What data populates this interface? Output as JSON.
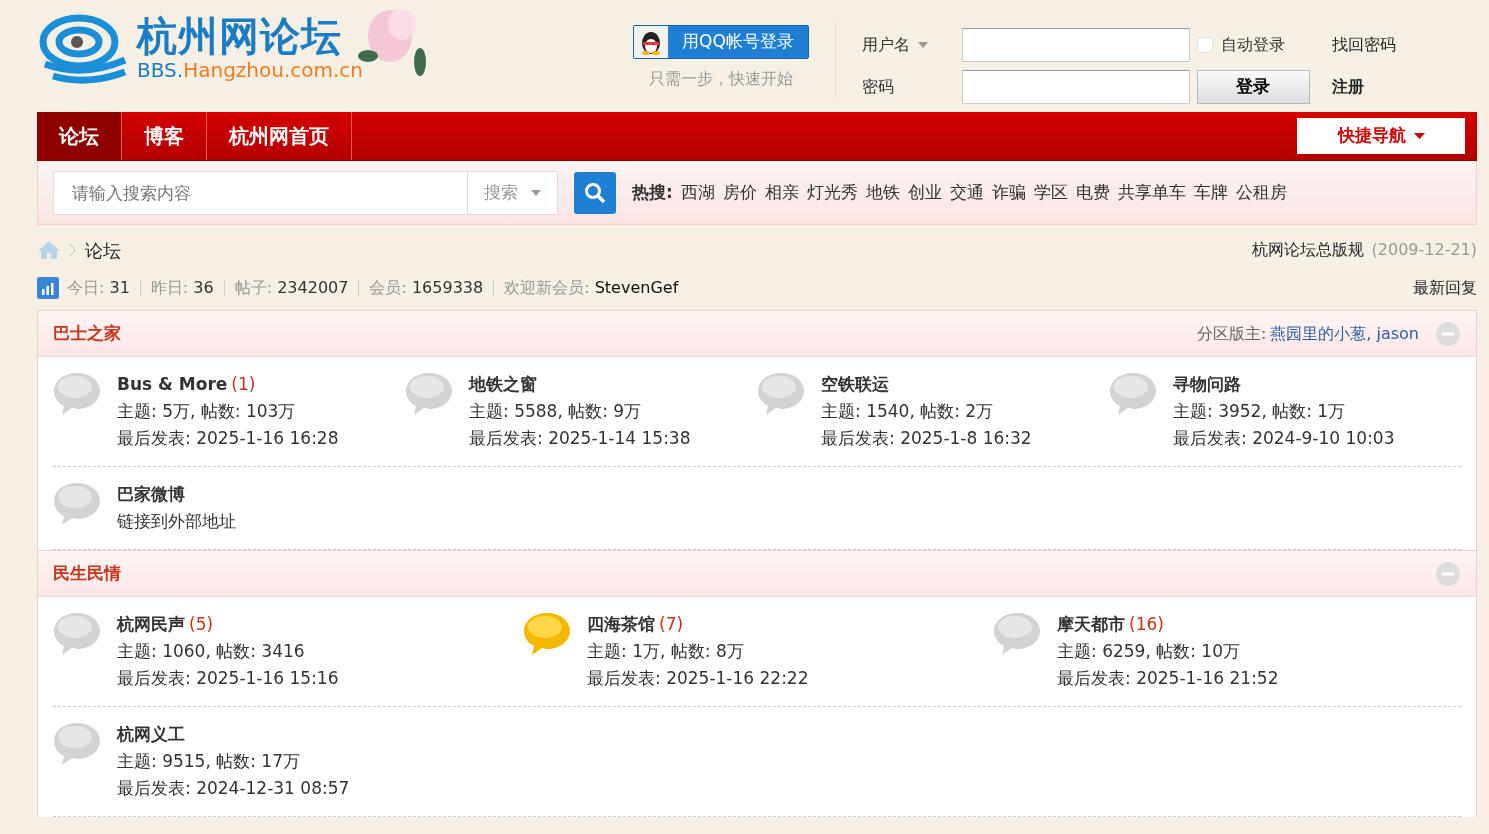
{
  "logo": {
    "title": "杭州网论坛",
    "url_prefix": "BBS.",
    "url_domain": "Hangzhou.com.cn"
  },
  "qq_login": {
    "button": "用QQ帐号登录",
    "hint": "只需一步，快速开始"
  },
  "login": {
    "username_label": "用户名",
    "password_label": "密码",
    "auto_login": {
      "label": "自动登录",
      "checked": false
    },
    "login_button": "登录",
    "forgot_link": "找回密码",
    "register_link": "注册"
  },
  "nav": {
    "items": [
      {
        "label": "论坛",
        "selected": true
      },
      {
        "label": "博客",
        "selected": false
      },
      {
        "label": "杭州网首页",
        "selected": false
      }
    ],
    "quick_nav": "快捷导航"
  },
  "search": {
    "placeholder": "请输入搜索内容",
    "type": "搜索",
    "hot_label": "热搜:",
    "hot": [
      "西湖",
      "房价",
      "相亲",
      "灯光秀",
      "地铁",
      "创业",
      "交通",
      "诈骗",
      "学区",
      "电费",
      "共享单车",
      "车牌",
      "公租房"
    ]
  },
  "breadcrumb": [
    "论坛"
  ],
  "rules": {
    "link": "杭网论坛总版规",
    "date": "(2009-12-21)"
  },
  "stats": [
    {
      "label": "今日:",
      "value": "31"
    },
    {
      "label": "昨日:",
      "value": "36"
    },
    {
      "label": "帖子:",
      "value": "2342007"
    },
    {
      "label": "会员:",
      "value": "1659338"
    },
    {
      "label": "欢迎新会员:",
      "value": "StevenGef"
    }
  ],
  "latest_link": "最新回复",
  "sections": [
    {
      "title": "巴士之家",
      "moderators_label": "分区版主:",
      "moderators": "燕园里的小葱, jason",
      "expanded": true,
      "forums": [
        {
          "name": "Bus & More",
          "today": "(1)",
          "stats": "主题: 5万, 帖数: 103万",
          "last": "最后发表: 2025-1-16 16:28",
          "has_new": false
        },
        {
          "name": "地铁之窗",
          "stats": "主题: 5588, 帖数: 9万",
          "last": "最后发表: 2025-1-14 15:38",
          "has_new": false
        },
        {
          "name": "空铁联运",
          "stats": "主题: 1540, 帖数: 2万",
          "last": "最后发表: 2025-1-8 16:32",
          "has_new": false
        },
        {
          "name": "寻物问路",
          "stats": "主题: 3952, 帖数: 1万",
          "last": "最后发表: 2024-9-10 10:03",
          "has_new": false
        },
        {
          "name": "巴家微博",
          "stats": "链接到外部地址",
          "has_new": false
        }
      ]
    },
    {
      "title": "民生民情",
      "expanded": true,
      "forums": [
        {
          "name": "杭网民声",
          "today": "(5)",
          "stats": "主题: 1060, 帖数: 3416",
          "last": "最后发表: 2025-1-16 15:16",
          "has_new": false
        },
        {
          "name": "四海茶馆",
          "today": "(7)",
          "stats": "主题: 1万, 帖数: 8万",
          "last": "最后发表: 2025-1-16 22:22",
          "has_new": true
        },
        {
          "name": "摩天都市",
          "today": "(16)",
          "stats": "主题: 6259, 帖数: 10万",
          "last": "最后发表: 2025-1-16 21:52",
          "has_new": false
        },
        {
          "name": "杭网义工",
          "stats": "主题: 9515, 帖数: 17万",
          "last": "最后发表: 2024-12-31 08:57",
          "has_new": false
        }
      ]
    }
  ]
}
